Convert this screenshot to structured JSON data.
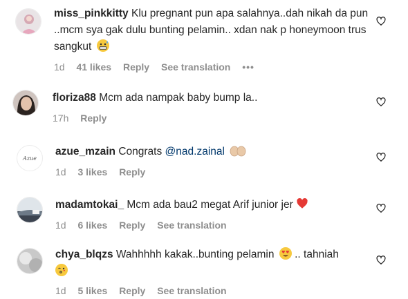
{
  "comments": [
    {
      "username": "miss_pinkkitty",
      "text": "Klu pregnant pun apa salahnya..dah nikah da pun ..mcm sya gak dulu bunting pelamin.. xdan nak p honeymoon trus sangkut",
      "emoji": "grimacing-sweat",
      "time": "1d",
      "likes": "41 likes",
      "reply": "Reply",
      "translate": "See translation",
      "more": "•••"
    },
    {
      "username": "floriza88",
      "text": "Mcm ada nampak baby bump la..",
      "time": "17h",
      "reply": "Reply"
    },
    {
      "username": "azue_mzain",
      "text": "Congrats",
      "mention": "@nad.zainal",
      "emoji": "open-hands",
      "avatar_text": "Azue",
      "time": "1d",
      "likes": "3 likes",
      "reply": "Reply"
    },
    {
      "username": "madamtokai_",
      "text": "Mcm ada bau2 megat Arif junior jer",
      "emoji": "red-heart",
      "time": "1d",
      "likes": "6 likes",
      "reply": "Reply",
      "translate": "See translation"
    },
    {
      "username": "chya_blqzs",
      "text": "Wahhhhh kakak..bunting pelamin",
      "emoji": "heart-eyes",
      "text2": ".. tahniah",
      "emoji2": "face-blowing-kiss",
      "time": "1d",
      "likes": "5 likes",
      "reply": "Reply",
      "translate": "See translation"
    }
  ],
  "colors": {
    "username": "#262626",
    "meta": "#8e8e8e",
    "mention": "#00376b"
  },
  "icons": {
    "like": "heart-outline-icon"
  }
}
